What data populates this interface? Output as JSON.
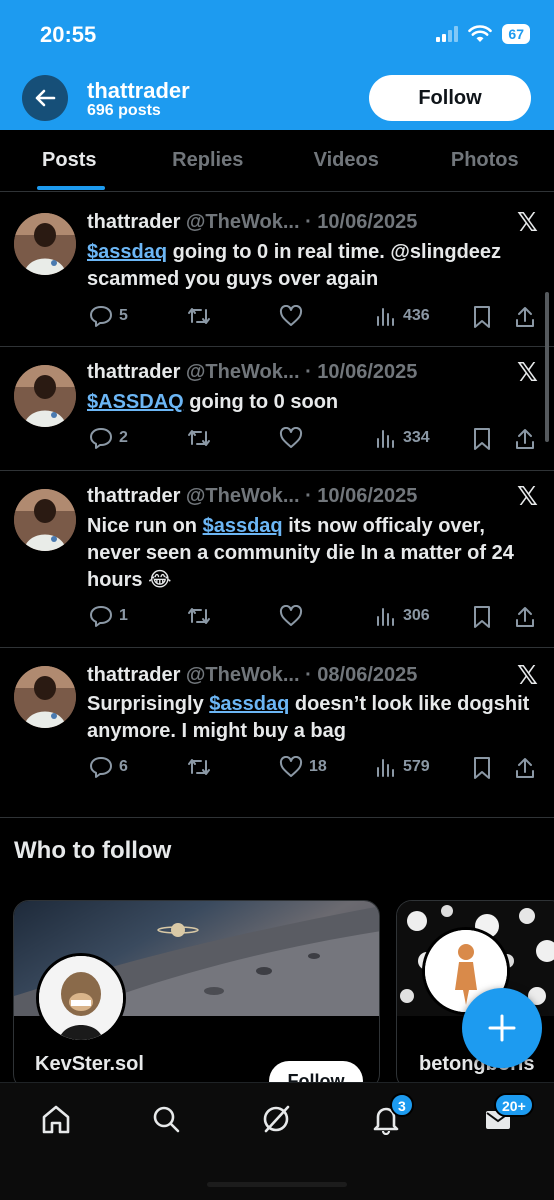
{
  "status_bar": {
    "time": "20:55",
    "battery": "67"
  },
  "profile": {
    "name": "thattrader",
    "posts": "696 posts",
    "follow_label": "Follow"
  },
  "tabs": [
    {
      "label": "Posts",
      "active": true
    },
    {
      "label": "Replies",
      "active": false
    },
    {
      "label": "Videos",
      "active": false
    },
    {
      "label": "Photos",
      "active": false
    }
  ],
  "tweets": [
    {
      "name": "thattrader",
      "handle": "@TheWok...",
      "date": "10/06/2025",
      "pre": "",
      "cashtag": "$assdaq",
      "post": " going to 0 in real time. @slingdeez scammed you guys over again",
      "replies": "5",
      "retweets": "",
      "likes": "",
      "views": "436"
    },
    {
      "name": "thattrader",
      "handle": "@TheWok...",
      "date": "10/06/2025",
      "pre": "",
      "cashtag": "$ASSDAQ",
      "post": " going to 0 soon",
      "replies": "2",
      "retweets": "",
      "likes": "",
      "views": "334"
    },
    {
      "name": "thattrader",
      "handle": "@TheWok...",
      "date": "10/06/2025",
      "pre": "Nice run on ",
      "cashtag": "$assdaq",
      "post": " its now officaly over, never seen a community die In a matter of 24 hours 😂",
      "replies": "1",
      "retweets": "",
      "likes": "",
      "views": "306"
    },
    {
      "name": "thattrader",
      "handle": "@TheWok...",
      "date": "08/06/2025",
      "pre": "Surprisingly ",
      "cashtag": "$assdaq",
      "post": " doesn’t look like dogshit anymore. I might buy a bag",
      "replies": "6",
      "retweets": "",
      "likes": "18",
      "views": "579"
    }
  ],
  "who_to_follow": {
    "title": "Who to follow",
    "cards": [
      {
        "name": "KevSter.sol",
        "follow_label": "Follow"
      },
      {
        "name": "betongboris"
      }
    ]
  },
  "nav": {
    "notifications_badge": "3",
    "messages_badge": "20+"
  },
  "colors": {
    "accent": "#1d9bf0",
    "background": "#000000",
    "muted": "#71767b",
    "link": "#6cb6f5"
  }
}
